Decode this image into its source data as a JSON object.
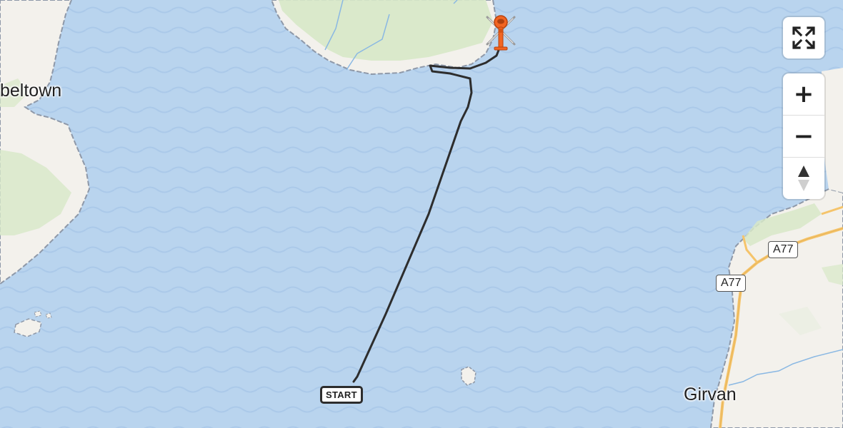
{
  "map": {
    "places": {
      "campbeltown": "beltown",
      "girvan": "Girvan"
    },
    "roads": [
      "A77",
      "A77"
    ],
    "route": {
      "start_label": "START",
      "color": "#2d2d2d"
    },
    "aircraft_icon": "helicopter-icon",
    "controls": {
      "fullscreen_icon": "fullscreen-icon",
      "zoom_in": "+",
      "zoom_out": "−",
      "compass_icon": "compass-icon"
    }
  },
  "colors": {
    "water": "#b9d4ee",
    "land": "#f3f1ec",
    "forest": "#d7e8c8",
    "coastline": "#8e98a8",
    "road_major": "#f5c46b",
    "stream": "#8ab8e3",
    "marker": "#f26522"
  }
}
